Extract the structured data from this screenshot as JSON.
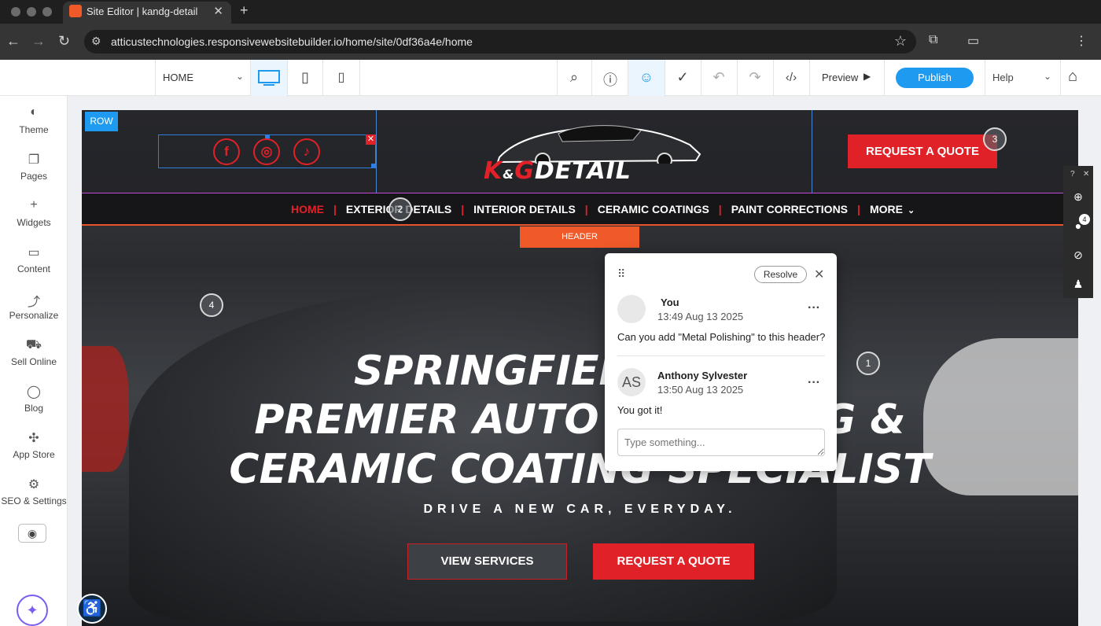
{
  "browser": {
    "tab_title": "Site Editor | kandg-detail",
    "tab_close": "✕",
    "new_tab": "+",
    "url": "atticustechnologies.responsivewebsitebuilder.io/home/site/0df36a4e/home"
  },
  "toolbar": {
    "page_select": "HOME",
    "preview_label": "Preview",
    "publish_label": "Publish",
    "help_label": "Help"
  },
  "sidebar": {
    "items": [
      {
        "label": "Theme",
        "icon": "palette-icon"
      },
      {
        "label": "Pages",
        "icon": "pages-icon"
      },
      {
        "label": "Widgets",
        "icon": "plus-icon"
      },
      {
        "label": "Content",
        "icon": "folder-icon"
      },
      {
        "label": "Personalize",
        "icon": "personalize-icon"
      },
      {
        "label": "Sell Online",
        "icon": "cart-icon"
      },
      {
        "label": "Blog",
        "icon": "chat-bubble-icon"
      },
      {
        "label": "App Store",
        "icon": "puzzle-icon"
      },
      {
        "label": "SEO & Settings",
        "icon": "gear-icon"
      }
    ]
  },
  "site": {
    "row_badge": "ROW",
    "logo_amp": "&",
    "logo_k": "K",
    "logo_g": "G",
    "logo_detail": "DETAIL",
    "header_quote": "REQUEST A QUOTE",
    "nav": [
      "HOME",
      "EXTERIOR DETAILS",
      "INTERIOR DETAILS",
      "CERAMIC COATINGS",
      "PAINT CORRECTIONS",
      "MORE"
    ],
    "header_label": "HEADER",
    "hero_line1": "SPRINGFIELD, MO'S",
    "hero_line2": "PREMIER AUTO DETAILING &",
    "hero_line3": "CERAMIC COATING SPECIALIST",
    "tagline": "DRIVE A NEW CAR, EVERYDAY.",
    "btn_services": "VIEW SERVICES",
    "btn_quote": "REQUEST A QUOTE",
    "pins": [
      "1",
      "2",
      "3",
      "4"
    ]
  },
  "right_tools": {
    "help": "?",
    "close": "✕",
    "comment_count": "4"
  },
  "comment": {
    "resolve_label": "Resolve",
    "entries": [
      {
        "avatar": "",
        "name": "You",
        "time": "13:49 Aug 13 2025",
        "text": "Can you add \"Metal Polishing\" to this header?"
      },
      {
        "avatar": "AS",
        "name": "Anthony Sylvester",
        "time": "13:50 Aug 13 2025",
        "text": "You got it!"
      }
    ],
    "input_placeholder": "Type something..."
  },
  "colors": {
    "brand_red": "#e02127",
    "accent_blue": "#1e9bf0",
    "header_orange": "#f05a28"
  }
}
